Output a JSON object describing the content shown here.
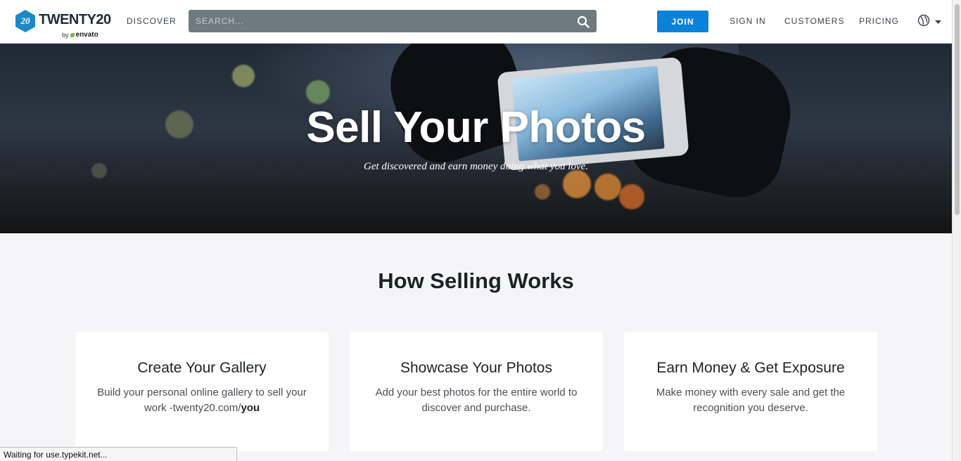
{
  "header": {
    "logo": {
      "badge_text": "20",
      "wordmark": "TWENTY20",
      "sub_by": "by",
      "sub_brand": "envato"
    },
    "nav": {
      "discover": "DISCOVER",
      "join": "JOIN",
      "sign_in": "SIGN IN",
      "customers": "CUSTOMERS",
      "pricing": "PRICING"
    },
    "search": {
      "placeholder": "SEARCH...",
      "value": ""
    },
    "icons": {
      "search": "search-icon",
      "globe": "globe-icon",
      "caret": "chevron-down-icon"
    }
  },
  "hero": {
    "title": "Sell Your Photos",
    "subtitle": "Get discovered and earn money doing what you love."
  },
  "how_it_works": {
    "title": "How Selling Works",
    "cards": [
      {
        "title": "Create Your Gallery",
        "text": "Build your personal online gallery to sell your work -twenty20.com/",
        "text_bold": "you"
      },
      {
        "title": "Showcase Your Photos",
        "text": "Add your best photos for the entire world to discover and purchase.",
        "text_bold": ""
      },
      {
        "title": "Earn Money & Get Exposure",
        "text": "Make money with every sale and get the recognition you deserve.",
        "text_bold": ""
      }
    ]
  },
  "status_bar": {
    "text": "Waiting for use.typekit.net..."
  },
  "colors": {
    "primary": "#0b82d9",
    "search_bg": "#6f7a80",
    "page_bg": "#f5f5f7",
    "logo_blue": "#1e88c7"
  }
}
